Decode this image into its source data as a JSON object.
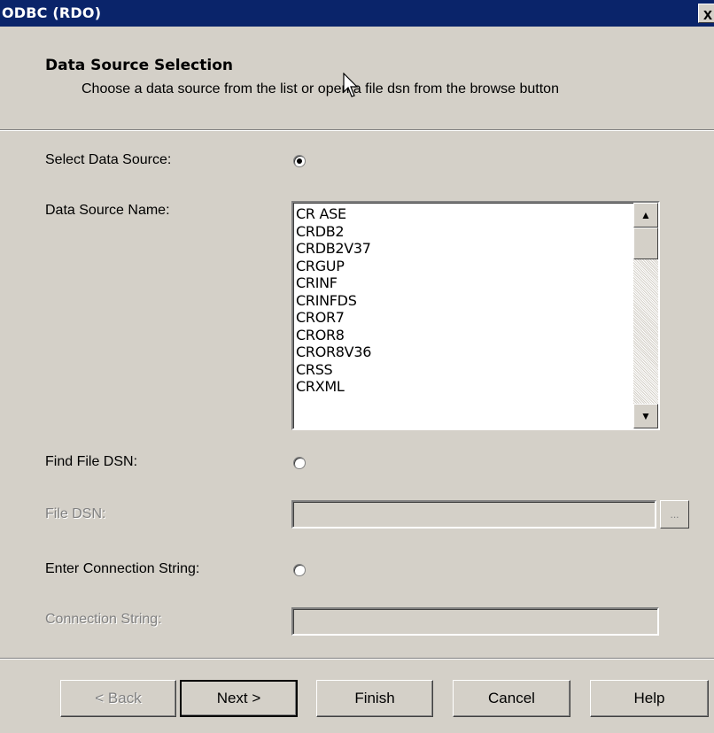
{
  "window": {
    "title": "ODBC (RDO)",
    "close_label": "x"
  },
  "header": {
    "title": "Data Source Selection",
    "subtitle": "Choose a data source from the list or open a file dsn from the browse button"
  },
  "form": {
    "select_data_source_label": "Select Data Source:",
    "data_source_name_label": "Data Source Name:",
    "find_file_dsn_label": "Find File DSN:",
    "file_dsn_label": "File DSN:",
    "enter_connection_string_label": "Enter Connection String:",
    "connection_string_label": "Connection String:",
    "file_dsn_value": "",
    "connection_string_value": "",
    "browse_label": "...",
    "selected_option": "Select Data Source"
  },
  "data_sources": [
    "CR ASE",
    "CRDB2",
    "CRDB2V37",
    "CRGUP",
    "CRINF",
    "CRINFDS",
    "CROR7",
    "CROR8",
    "CROR8V36",
    "CRSS",
    "CRXML"
  ],
  "scrollbar": {
    "up_icon": "▲",
    "down_icon": "▼"
  },
  "buttons": {
    "back": "< Back",
    "next": "Next >",
    "finish": "Finish",
    "cancel": "Cancel",
    "help": "Help"
  },
  "colors": {
    "titlebar": "#0a246a",
    "dialog_face": "#d4d0c8"
  },
  "icons": [
    "close-icon",
    "radio-selected",
    "radio-unselected",
    "scroll-up-icon",
    "scroll-down-icon",
    "mouse-pointer-icon"
  ]
}
